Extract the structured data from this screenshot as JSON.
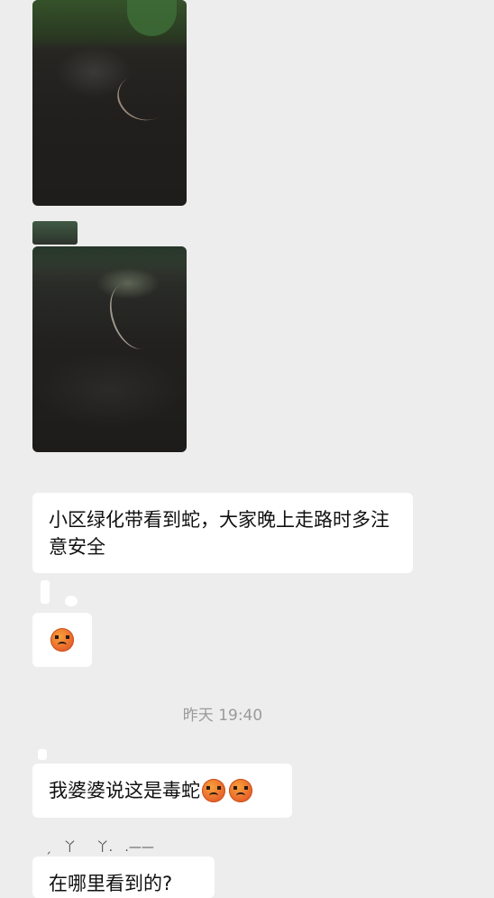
{
  "messages": {
    "msg1_text": "小区绿化带看到蛇，大家晚上走路时多注意安全",
    "msg3_text": "我婆婆说这是毒蛇",
    "msg4_text": "在哪里看到的?"
  },
  "timestamp": "昨天 19:40",
  "emojis": {
    "icon": "crying-face-emoji",
    "color": "#e8612a"
  },
  "theme": {
    "background": "#ededed",
    "bubble": "#ffffff",
    "timestamp_color": "#9a9a9a"
  },
  "noise_text": "ˏ   丫     丫.   .——"
}
